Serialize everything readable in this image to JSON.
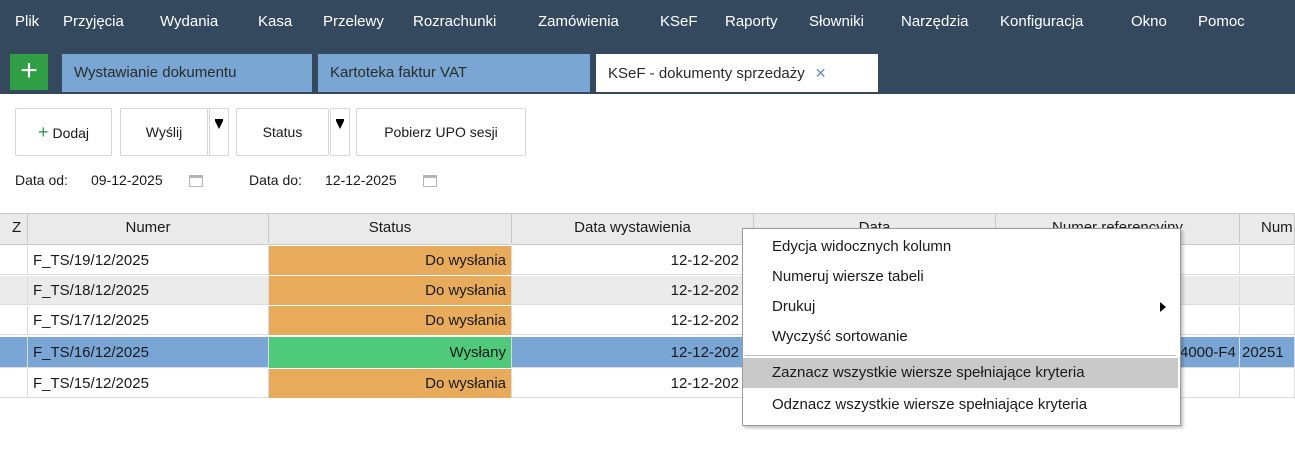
{
  "menubar": [
    "Plik",
    "Przyjęcia",
    "Wydania",
    "Kasa",
    "Przelewy",
    "Rozrachunki",
    "Zamówienia",
    "KSeF",
    "Raporty",
    "Słowniki",
    "Narzędzia",
    "Konfiguracja",
    "Okno",
    "Pomoc"
  ],
  "tabs": [
    {
      "label": "Wystawianie dokumentu"
    },
    {
      "label": "Kartoteka faktur VAT"
    },
    {
      "label": "KSeF - dokumenty sprzedaży",
      "close": "✕"
    }
  ],
  "plus_label": "+",
  "toolbar": {
    "add": "Dodaj",
    "send": "Wyślij",
    "status": "Status",
    "download_upo": "Pobierz UPO sesji"
  },
  "dates": {
    "from_label": "Data od:",
    "from_value": "09-12-2025",
    "to_label": "Data do:",
    "to_value": "12-12-2025"
  },
  "table": {
    "headers": [
      "Z",
      "Numer",
      "Status",
      "Data wystawienia",
      "Data",
      "Numer referencyjny",
      "Num"
    ],
    "rows": [
      {
        "numer": "F_TS/19/12/2025",
        "status": "Do wysłania",
        "data": "12-12-202",
        "ref": "",
        "num": ""
      },
      {
        "numer": "F_TS/18/12/2025",
        "status": "Do wysłania",
        "data": "12-12-202",
        "ref": "",
        "num": ""
      },
      {
        "numer": "F_TS/17/12/2025",
        "status": "Do wysłania",
        "data": "12-12-202",
        "ref": "",
        "num": ""
      },
      {
        "numer": "F_TS/16/12/2025",
        "status": "Wysłany",
        "data": "12-12-202",
        "ref": "4000-F4",
        "num": "20251"
      },
      {
        "numer": "F_TS/15/12/2025",
        "status": "Do wysłania",
        "data": "12-12-202",
        "ref": "",
        "num": ""
      }
    ]
  },
  "context_menu": {
    "items": [
      "Edycja widocznych kolumn",
      "Numeruj wiersze tabeli",
      "Drukuj",
      "Wyczyść sortowanie",
      "Zaznacz wszystkie wiersze spełniające kryteria",
      "Odznacz wszystkie wiersze spełniające kryteria"
    ]
  },
  "colors": {
    "status_pending": "#e8ab5c",
    "status_sent": "#4fc97a",
    "selected_row": "#7aa6d6"
  }
}
